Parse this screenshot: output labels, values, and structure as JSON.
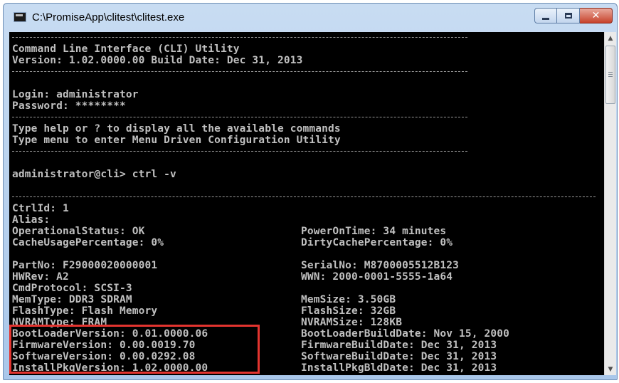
{
  "window": {
    "title": "C:\\PromiseApp\\clitest\\clitest.exe",
    "icon": "console-app-icon",
    "buttons": {
      "minimize": "minimize-icon",
      "maximize": "maximize-icon",
      "close": "close-icon",
      "close_glyph": "✕"
    }
  },
  "console": {
    "header": [
      "Command Line Interface (CLI) Utility",
      "Version: 1.02.0000.00 Build Date: Dec 31, 2013"
    ],
    "login": [
      "Login: administrator",
      "Password: ********"
    ],
    "help": [
      "Type help or ? to display all the available commands",
      "Type menu to enter Menu Driven Configuration Utility"
    ],
    "prompt": "administrator@cli> ctrl -v",
    "output_top": [
      "CtrlId: 1",
      "Alias:"
    ],
    "status_left": [
      "OperationalStatus: OK",
      "CacheUsagePercentage: 0%"
    ],
    "status_right": [
      "PowerOnTime: 34 minutes",
      "DirtyCachePercentage: 0%"
    ],
    "hw_left": [
      "PartNo: F29000020000001",
      "HWRev: A2",
      "CmdProtocol: SCSI-3",
      "MemType: DDR3 SDRAM",
      "FlashType: Flash Memory",
      "NVRAMType: FRAM"
    ],
    "hw_right": [
      "SerialNo: M8700005512B123",
      "WWN: 2000-0001-5555-1a64",
      "",
      "MemSize: 3.50GB",
      "FlashSize: 32GB",
      "NVRAMSize: 128KB"
    ],
    "version_left": [
      "BootLoaderVersion: 0.01.0000.06",
      "FirmwareVersion: 0.00.0019.70",
      "SoftwareVersion: 0.00.0292.08",
      "InstallPkgVersion: 1.02.0000.00"
    ],
    "version_right": [
      "BootLoaderBuildDate: Nov 15, 2000",
      "FirmwareBuildDate: Dec 31, 2013",
      "SoftwareBuildDate: Dec 31, 2013",
      "InstallPkgBldDate: Dec 31, 2013"
    ]
  },
  "colors": {
    "console_bg": "#000000",
    "console_text": "#c0c0c0",
    "highlight_box": "#e3342f",
    "titlebar": "#b9d1ee"
  },
  "scrollbar": {
    "up_glyph": "▲",
    "down_glyph": "▼"
  }
}
